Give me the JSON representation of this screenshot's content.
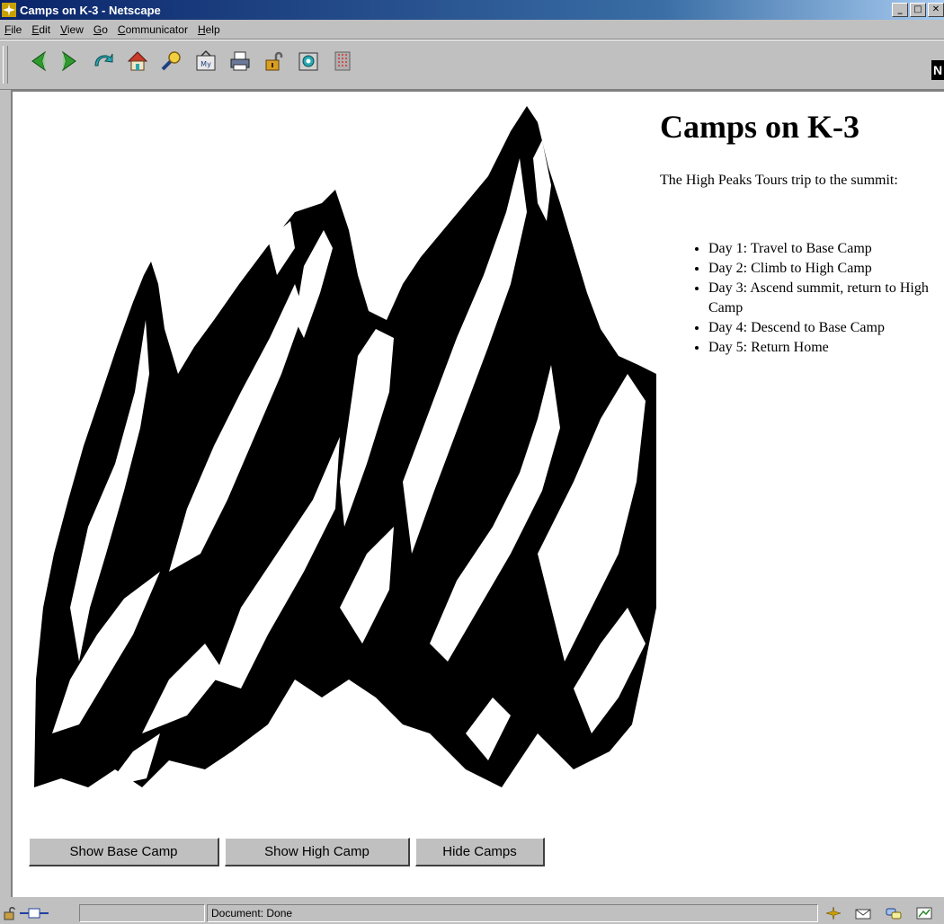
{
  "window": {
    "title": "Camps on K-3 - Netscape",
    "controls": {
      "minimize": "_",
      "maximize": "□",
      "close": "✕"
    }
  },
  "menubar": {
    "items": [
      {
        "label": "File",
        "underline": "F",
        "rest": "ile"
      },
      {
        "label": "Edit",
        "underline": "E",
        "rest": "dit"
      },
      {
        "label": "View",
        "underline": "V",
        "rest": "iew"
      },
      {
        "label": "Go",
        "underline": "G",
        "rest": "o"
      },
      {
        "label": "Communicator",
        "underline": "C",
        "rest": "ommunicator"
      },
      {
        "label": "Help",
        "underline": "H",
        "rest": "elp"
      }
    ]
  },
  "toolbar": {
    "icons": [
      "back-icon",
      "forward-icon",
      "reload-icon",
      "home-icon",
      "search-icon",
      "my-netscape-icon",
      "print-icon",
      "security-icon",
      "shop-icon",
      "stop-icon"
    ],
    "brand_letter": "N"
  },
  "page": {
    "heading": "Camps on K-3",
    "intro": "The High Peaks Tours trip to the summit:",
    "days": [
      "Day 1: Travel to Base Camp",
      "Day 2: Climb to High Camp",
      "Day 3: Ascend summit, return to High Camp",
      "Day 4: Descend to Base Camp",
      "Day 5: Return Home"
    ],
    "buttons": {
      "show_base": "Show Base Camp",
      "show_high": "Show High Camp",
      "hide": "Hide Camps"
    }
  },
  "statusbar": {
    "status_text": "Document: Done"
  },
  "colors": {
    "titlebar_start": "#0a246a",
    "chrome": "#c0c0c0",
    "content_bg": "#ffffff"
  }
}
